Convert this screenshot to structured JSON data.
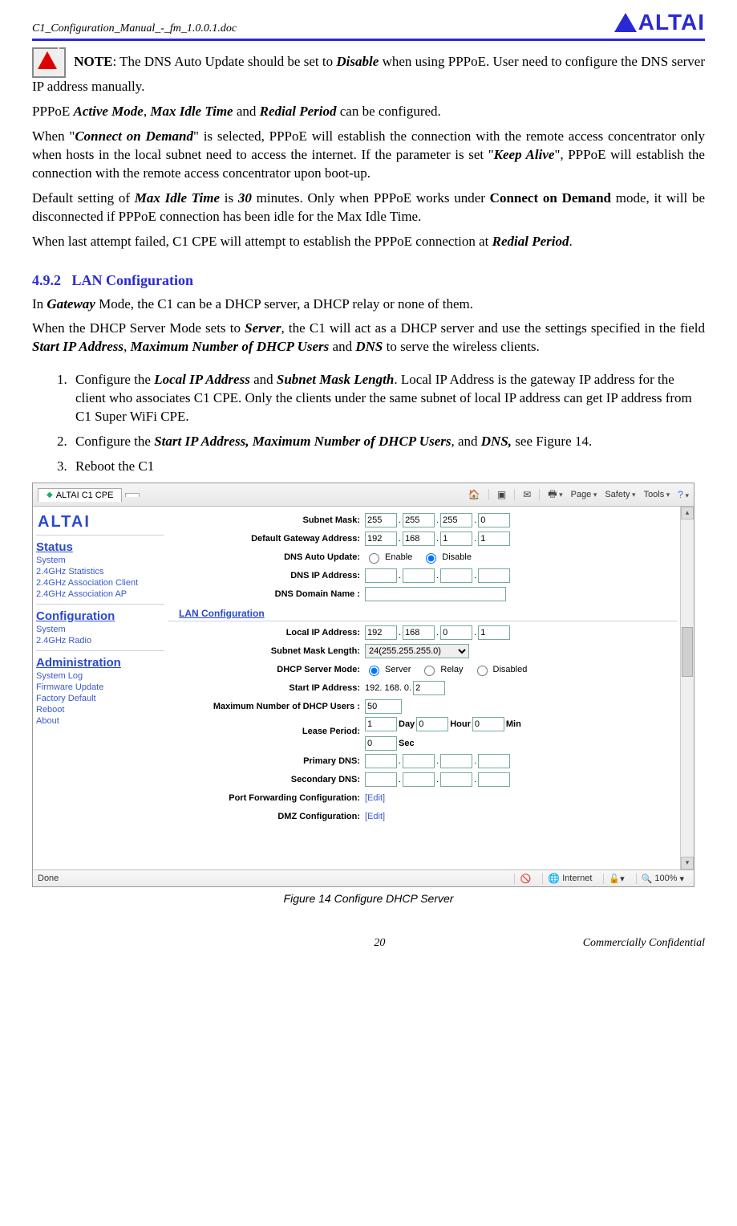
{
  "doc": {
    "filename": "C1_Configuration_Manual_-_fm_1.0.0.1.doc",
    "brand": "ALTAI",
    "page_number": "20",
    "confidential": "Commercially Confidential"
  },
  "content": {
    "note_label": "NOTE",
    "note_text_1": ": The DNS Auto Update should be set to ",
    "note_disable": "Disable",
    "note_text_2": " when using PPPoE. User need to configure the DNS server IP address manually.",
    "p2_a": "PPPoE ",
    "p2_active": "Active Mode",
    "p2_b": ", ",
    "p2_idle": "Max Idle Time",
    "p2_c": " and ",
    "p2_redial": "Redial Period",
    "p2_d": " can be configured.",
    "p3_a": "When \"",
    "p3_cod": "Connect on Demand",
    "p3_b": "\" is selected, PPPoE will establish the connection with the remote access concentrator only when hosts in the local subnet need to access the internet. If the parameter is set \"",
    "p3_keep": "Keep Alive",
    "p3_c": "\", PPPoE will establish the connection with the remote access concentrator upon boot-up.",
    "p4_a": "Default setting of ",
    "p4_idle": "Max Idle Time",
    "p4_b": " is ",
    "p4_30": "30",
    "p4_c": " minutes. Only when PPPoE works under ",
    "p4_cod": "Connect on Demand",
    "p4_d": " mode, it will be disconnected if PPPoE connection has been idle for the Max Idle Time.",
    "p5_a": "When last attempt failed, C1 CPE will attempt to establish the PPPoE connection at ",
    "p5_redial": "Redial Period",
    "p5_b": ".",
    "sec_num": "4.9.2",
    "sec_title": "LAN Configuration",
    "p6_a": "In ",
    "p6_gw": "Gateway",
    "p6_b": " Mode, the C1 can be a DHCP server, a DHCP relay or none of them.",
    "p7_a": "When the DHCP Server Mode sets to ",
    "p7_srv": "Server",
    "p7_b": ", the C1 will act as a DHCP server and use the settings specified in the field ",
    "p7_sip": "Start IP Address",
    "p7_c": ", ",
    "p7_max": "Maximum Number of DHCP Users",
    "p7_d": " and ",
    "p7_dns": "DNS",
    "p7_e": " to serve the wireless clients.",
    "step1_a": "Configure the ",
    "step1_lip": "Local IP Address",
    "step1_b": " and ",
    "step1_sml": "Subnet Mask Length",
    "step1_c": ". Local IP Address is the gateway IP address for the client who associates C1 CPE. Only the clients under the same subnet of local IP address can get IP address from C1 Super WiFi CPE.",
    "step2_a": "Configure the ",
    "step2_sip": "Start IP Address, Maximum Number of DHCP Users",
    "step2_b": ", and ",
    "step2_dns": "DNS,",
    "step2_c": " see Figure 14.",
    "step3": "Reboot the C1"
  },
  "screenshot": {
    "tab_title": "ALTAI C1 CPE",
    "toolbar": {
      "page": "Page",
      "safety": "Safety",
      "tools": "Tools"
    },
    "sidebar": {
      "logo": "ALTAI",
      "status_hdr": "Status",
      "status_items": [
        "System",
        "2.4GHz Statistics",
        "2.4GHz Association Client",
        "2.4GHz Association AP"
      ],
      "config_hdr": "Configuration",
      "config_items": [
        "System",
        "2.4GHz Radio"
      ],
      "admin_hdr": "Administration",
      "admin_items": [
        "System Log",
        "Firmware Update",
        "Factory Default",
        "Reboot",
        "About"
      ]
    },
    "labels": {
      "subnet_mask": "Subnet Mask:",
      "default_gw": "Default Gateway Address:",
      "dns_auto": "DNS Auto Update:",
      "dns_ip": "DNS IP Address:",
      "dns_domain": "DNS Domain Name :",
      "lan_hdr": "LAN Configuration",
      "local_ip": "Local IP Address:",
      "sml": "Subnet Mask Length:",
      "dhcp_mode": "DHCP Server Mode:",
      "start_ip": "Start IP Address:",
      "max_users": "Maximum Number of DHCP Users :",
      "lease": "Lease Period:",
      "pdns": "Primary DNS:",
      "sdns": "Secondary DNS:",
      "portfwd": "Port Forwarding Configuration:",
      "dmz": "DMZ Configuration:"
    },
    "values": {
      "subnet_mask": [
        "255",
        "255",
        "255",
        "0"
      ],
      "default_gw": [
        "192",
        "168",
        "1",
        "1"
      ],
      "dns_auto_enable": "Enable",
      "dns_auto_disable": "Disable",
      "local_ip": [
        "192",
        "168",
        "0",
        "1"
      ],
      "sml_option": "24(255.255.255.0)",
      "dhcp_server": "Server",
      "dhcp_relay": "Relay",
      "dhcp_disabled": "Disabled",
      "start_ip_prefix": "192. 168. 0.",
      "start_ip_last": "2",
      "max_users": "50",
      "lease_day_v": "1",
      "lease_day": "Day",
      "lease_hour_v": "0",
      "lease_hour": "Hour",
      "lease_min_v": "0",
      "lease_min": "Min",
      "lease_sec_v": "0",
      "lease_sec": "Sec",
      "edit": "[Edit]"
    },
    "status": {
      "done": "Done",
      "internet": "Internet",
      "zoom": "100%"
    }
  },
  "figure_caption": "Figure 14    Configure DHCP Server"
}
